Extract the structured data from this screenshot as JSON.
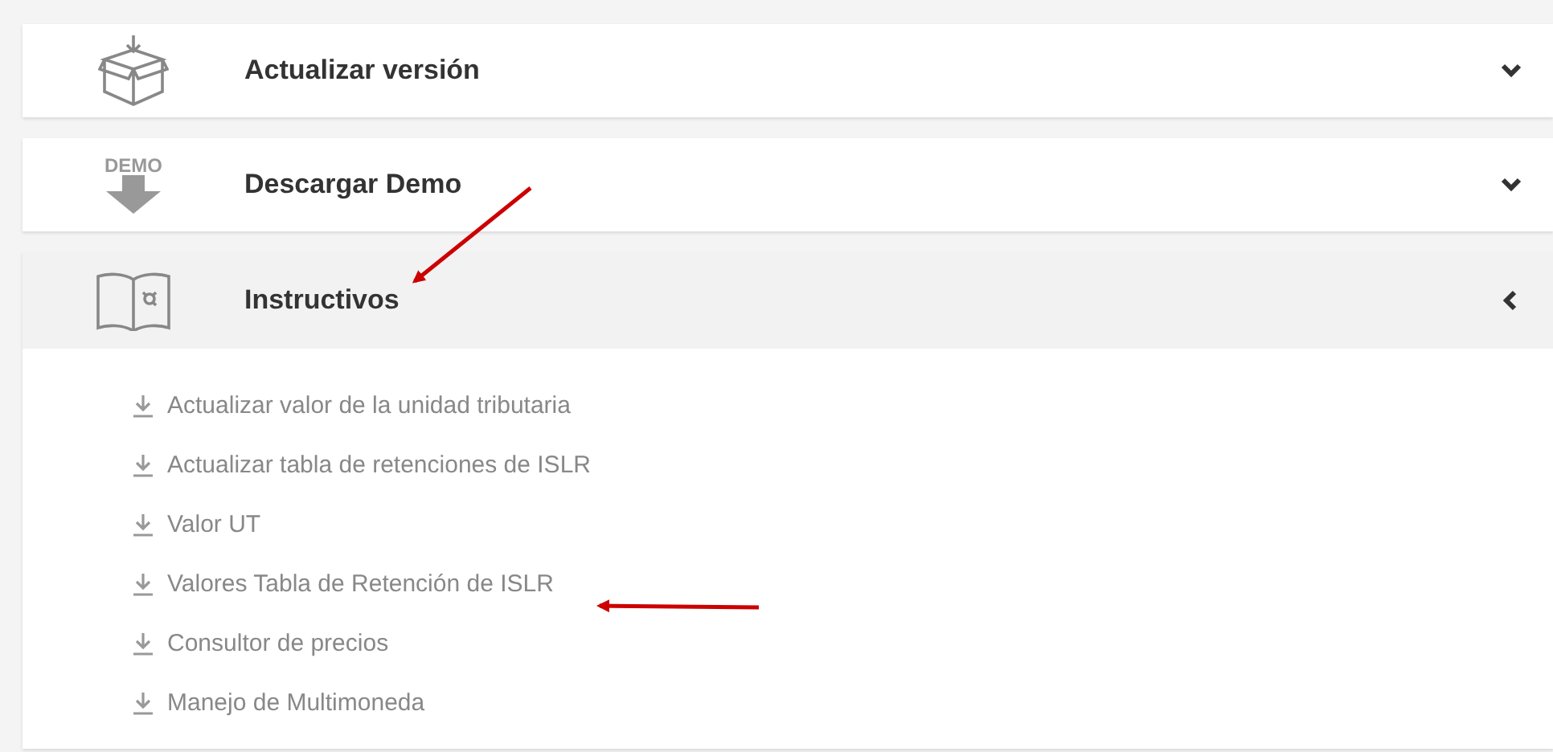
{
  "panels": [
    {
      "title": "Actualizar versión",
      "expanded": false
    },
    {
      "title": "Descargar Demo",
      "icon_text": "DEMO",
      "expanded": false
    },
    {
      "title": "Instructivos",
      "expanded": true,
      "items": [
        {
          "label": "Actualizar valor de la unidad tributaria"
        },
        {
          "label": "Actualizar tabla de retenciones de ISLR"
        },
        {
          "label": "Valor UT"
        },
        {
          "label": "Valores Tabla de Retención de ISLR"
        },
        {
          "label": "Consultor de precios"
        },
        {
          "label": "Manejo de Multimoneda"
        }
      ]
    }
  ],
  "annotations": [
    {
      "kind": "arrow"
    },
    {
      "kind": "arrow"
    }
  ]
}
